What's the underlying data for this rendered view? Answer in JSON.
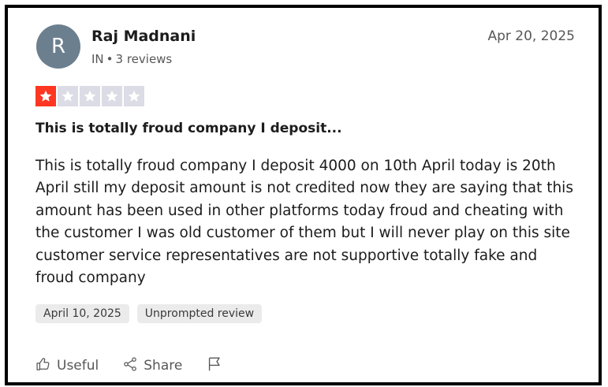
{
  "review": {
    "avatar_initial": "R",
    "author_name": "Raj Madnani",
    "country": "IN",
    "separator": "•",
    "review_count": "3 reviews",
    "date_posted": "Apr 20, 2025",
    "rating": 1,
    "rating_max": 5,
    "title": "This is totally froud company I deposit...",
    "text": "This is totally froud company I deposit 4000 on 10th April today is 20th April still my deposit amount is not credited now they are saying that this amount has been used in other platforms today froud and cheating with the customer I was old customer of them but I will never play on this site customer service representatives are not supportive totally fake and froud company",
    "tags": {
      "experience_date": "April 10, 2025",
      "review_type": "Unprompted review"
    }
  },
  "actions": {
    "useful_label": "Useful",
    "share_label": "Share"
  },
  "icons": {
    "useful": "thumbs-up-icon",
    "share": "share-icon",
    "flag": "flag-icon",
    "star": "star-icon"
  },
  "colors": {
    "star_filled": "#ff3722",
    "star_empty": "#dcdce6",
    "avatar_bg": "#6c7f8f",
    "tag_bg": "#ebebeb"
  }
}
